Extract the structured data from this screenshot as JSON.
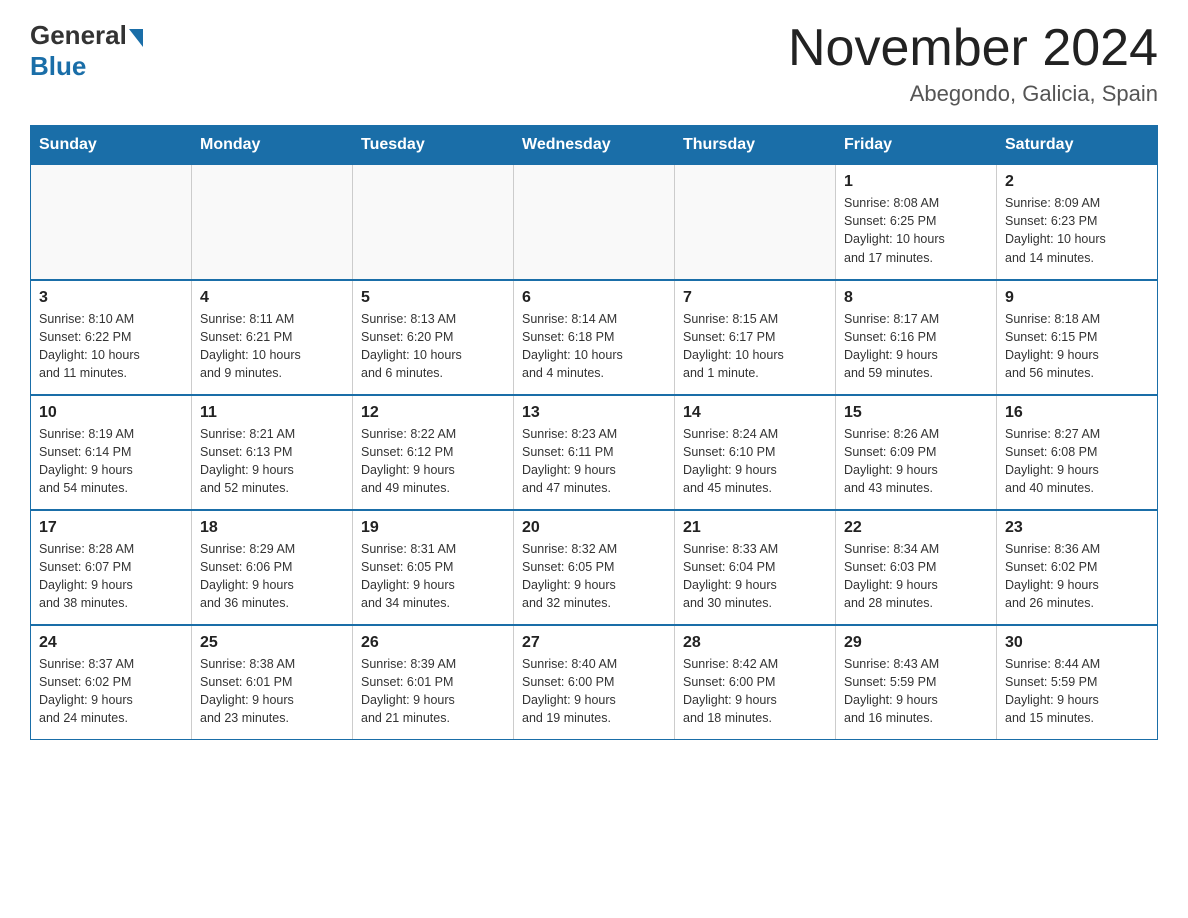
{
  "header": {
    "logo_general": "General",
    "logo_blue": "Blue",
    "month": "November 2024",
    "location": "Abegondo, Galicia, Spain"
  },
  "days_of_week": [
    "Sunday",
    "Monday",
    "Tuesday",
    "Wednesday",
    "Thursday",
    "Friday",
    "Saturday"
  ],
  "weeks": [
    [
      {
        "day": "",
        "info": ""
      },
      {
        "day": "",
        "info": ""
      },
      {
        "day": "",
        "info": ""
      },
      {
        "day": "",
        "info": ""
      },
      {
        "day": "",
        "info": ""
      },
      {
        "day": "1",
        "info": "Sunrise: 8:08 AM\nSunset: 6:25 PM\nDaylight: 10 hours\nand 17 minutes."
      },
      {
        "day": "2",
        "info": "Sunrise: 8:09 AM\nSunset: 6:23 PM\nDaylight: 10 hours\nand 14 minutes."
      }
    ],
    [
      {
        "day": "3",
        "info": "Sunrise: 8:10 AM\nSunset: 6:22 PM\nDaylight: 10 hours\nand 11 minutes."
      },
      {
        "day": "4",
        "info": "Sunrise: 8:11 AM\nSunset: 6:21 PM\nDaylight: 10 hours\nand 9 minutes."
      },
      {
        "day": "5",
        "info": "Sunrise: 8:13 AM\nSunset: 6:20 PM\nDaylight: 10 hours\nand 6 minutes."
      },
      {
        "day": "6",
        "info": "Sunrise: 8:14 AM\nSunset: 6:18 PM\nDaylight: 10 hours\nand 4 minutes."
      },
      {
        "day": "7",
        "info": "Sunrise: 8:15 AM\nSunset: 6:17 PM\nDaylight: 10 hours\nand 1 minute."
      },
      {
        "day": "8",
        "info": "Sunrise: 8:17 AM\nSunset: 6:16 PM\nDaylight: 9 hours\nand 59 minutes."
      },
      {
        "day": "9",
        "info": "Sunrise: 8:18 AM\nSunset: 6:15 PM\nDaylight: 9 hours\nand 56 minutes."
      }
    ],
    [
      {
        "day": "10",
        "info": "Sunrise: 8:19 AM\nSunset: 6:14 PM\nDaylight: 9 hours\nand 54 minutes."
      },
      {
        "day": "11",
        "info": "Sunrise: 8:21 AM\nSunset: 6:13 PM\nDaylight: 9 hours\nand 52 minutes."
      },
      {
        "day": "12",
        "info": "Sunrise: 8:22 AM\nSunset: 6:12 PM\nDaylight: 9 hours\nand 49 minutes."
      },
      {
        "day": "13",
        "info": "Sunrise: 8:23 AM\nSunset: 6:11 PM\nDaylight: 9 hours\nand 47 minutes."
      },
      {
        "day": "14",
        "info": "Sunrise: 8:24 AM\nSunset: 6:10 PM\nDaylight: 9 hours\nand 45 minutes."
      },
      {
        "day": "15",
        "info": "Sunrise: 8:26 AM\nSunset: 6:09 PM\nDaylight: 9 hours\nand 43 minutes."
      },
      {
        "day": "16",
        "info": "Sunrise: 8:27 AM\nSunset: 6:08 PM\nDaylight: 9 hours\nand 40 minutes."
      }
    ],
    [
      {
        "day": "17",
        "info": "Sunrise: 8:28 AM\nSunset: 6:07 PM\nDaylight: 9 hours\nand 38 minutes."
      },
      {
        "day": "18",
        "info": "Sunrise: 8:29 AM\nSunset: 6:06 PM\nDaylight: 9 hours\nand 36 minutes."
      },
      {
        "day": "19",
        "info": "Sunrise: 8:31 AM\nSunset: 6:05 PM\nDaylight: 9 hours\nand 34 minutes."
      },
      {
        "day": "20",
        "info": "Sunrise: 8:32 AM\nSunset: 6:05 PM\nDaylight: 9 hours\nand 32 minutes."
      },
      {
        "day": "21",
        "info": "Sunrise: 8:33 AM\nSunset: 6:04 PM\nDaylight: 9 hours\nand 30 minutes."
      },
      {
        "day": "22",
        "info": "Sunrise: 8:34 AM\nSunset: 6:03 PM\nDaylight: 9 hours\nand 28 minutes."
      },
      {
        "day": "23",
        "info": "Sunrise: 8:36 AM\nSunset: 6:02 PM\nDaylight: 9 hours\nand 26 minutes."
      }
    ],
    [
      {
        "day": "24",
        "info": "Sunrise: 8:37 AM\nSunset: 6:02 PM\nDaylight: 9 hours\nand 24 minutes."
      },
      {
        "day": "25",
        "info": "Sunrise: 8:38 AM\nSunset: 6:01 PM\nDaylight: 9 hours\nand 23 minutes."
      },
      {
        "day": "26",
        "info": "Sunrise: 8:39 AM\nSunset: 6:01 PM\nDaylight: 9 hours\nand 21 minutes."
      },
      {
        "day": "27",
        "info": "Sunrise: 8:40 AM\nSunset: 6:00 PM\nDaylight: 9 hours\nand 19 minutes."
      },
      {
        "day": "28",
        "info": "Sunrise: 8:42 AM\nSunset: 6:00 PM\nDaylight: 9 hours\nand 18 minutes."
      },
      {
        "day": "29",
        "info": "Sunrise: 8:43 AM\nSunset: 5:59 PM\nDaylight: 9 hours\nand 16 minutes."
      },
      {
        "day": "30",
        "info": "Sunrise: 8:44 AM\nSunset: 5:59 PM\nDaylight: 9 hours\nand 15 minutes."
      }
    ]
  ]
}
